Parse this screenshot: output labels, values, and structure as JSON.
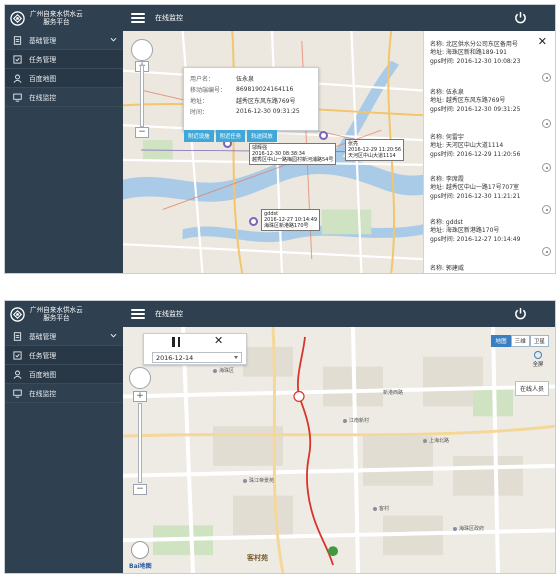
{
  "app": {
    "brand_line1": "广州自来水供水云",
    "brand_line2": "服务平台",
    "page_title": "在线监控"
  },
  "sidebar": {
    "items": [
      {
        "label": "基础管理",
        "icon": "document-icon"
      },
      {
        "label": "任务管理",
        "icon": "task-icon"
      },
      {
        "label": "百度地图",
        "icon": "person-icon"
      },
      {
        "label": "在线监控",
        "icon": "monitor-icon"
      }
    ]
  },
  "popup": {
    "user_label": "用户名：",
    "user_value": "伍永泉",
    "imei_label": "移动端编号：",
    "imei_value": "869819024164116",
    "addr_label": "地址：",
    "addr_value": "越秀区东风东路769号",
    "time_label": "时间：",
    "time_value": "2016-12-30 09:31:25",
    "actions": [
      "附近设施",
      "附近任务",
      "轨迹回放"
    ]
  },
  "map_tags": [
    {
      "text": "伍永泉\n2016-12-30 09:31:25\n越秀区东风东路769号"
    },
    {
      "text": "张亮\n2016-12-29 11:20:56\n天河区中山大道1114"
    },
    {
      "text": "gddst\n2016-12-27 10:14:49\n海珠区新港路170号"
    },
    {
      "text": "邬辉强\n2016-12-30 08:38:34\n越秀区中山一路梅园村新河浦路54号"
    }
  ],
  "device_list": [
    {
      "name": "名称: 北区供水分公司东区备用号",
      "addr": "地址: 海珠区新和路189-191",
      "gps": "gps时间: 2016-12-30 10:08:23"
    },
    {
      "name": "名称: 伍永泉",
      "addr": "地址: 越秀区东风东路769号",
      "gps": "gps时间: 2016-12-30 09:31:25"
    },
    {
      "name": "名称: 何雷宇",
      "addr": "地址: 天河区中山大道1114",
      "gps": "gps时间: 2016-12-29 11:20:56"
    },
    {
      "name": "名称: 李席霞",
      "addr": "地址: 越秀区中山一路17号707室",
      "gps": "gps时间: 2016-12-30 11:21:21"
    },
    {
      "name": "名称: gddst",
      "addr": "地址: 海珠区新港路170号",
      "gps": "gps时间: 2016-12-27 10:14:49"
    },
    {
      "name": "名称: 郭建威",
      "addr": "",
      "gps": ""
    }
  ],
  "playback": {
    "date": "2016-12-14"
  },
  "map2": {
    "maptypes": [
      "地图",
      "三维",
      "卫星"
    ],
    "fullscreen_label": "全屏",
    "online_btn": "在线人员",
    "district": "客村苑",
    "baidu": "Bai地图",
    "pois": [
      "海珠区",
      "江南新村",
      "新港西路",
      "上海北路",
      "客村",
      "珠江帝景苑",
      "海珠区政府"
    ]
  },
  "colors": {
    "sidebar_bg": "#2f4050",
    "accent": "#3fa8d8",
    "route": "#d9342b"
  }
}
